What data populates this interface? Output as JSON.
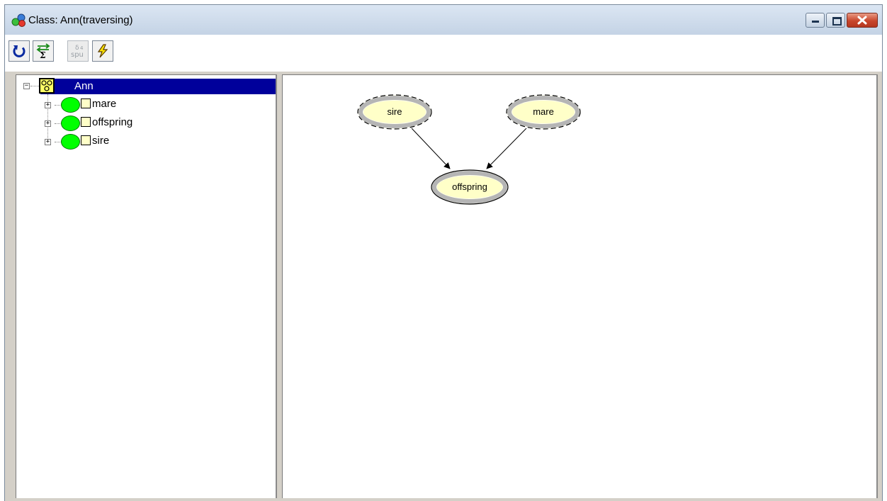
{
  "window": {
    "title": "Class: Ann(traversing)"
  },
  "toolbar": {
    "buttons": [
      {
        "name": "refresh",
        "icon": "refresh-icon"
      },
      {
        "name": "sum-propagate",
        "icon": "sum-arrows-icon"
      },
      {
        "name": "spu",
        "icon": "spu-icon",
        "label": "spu",
        "disabled": true
      },
      {
        "name": "lightning",
        "icon": "lightning-icon"
      }
    ]
  },
  "tree": {
    "root": {
      "label": "Ann",
      "icon": "class-icon"
    },
    "children": [
      {
        "label": "mare"
      },
      {
        "label": "offspring"
      },
      {
        "label": "sire"
      }
    ]
  },
  "graph": {
    "nodes": [
      {
        "label": "sire"
      },
      {
        "label": "mare"
      },
      {
        "label": "offspring"
      }
    ],
    "edges": [
      {
        "from": "sire",
        "to": "offspring"
      },
      {
        "from": "mare",
        "to": "offspring"
      }
    ]
  },
  "colors": {
    "selection": "#00009b",
    "node_dot": "#00ff00",
    "node_fill": "#ffffc8"
  }
}
